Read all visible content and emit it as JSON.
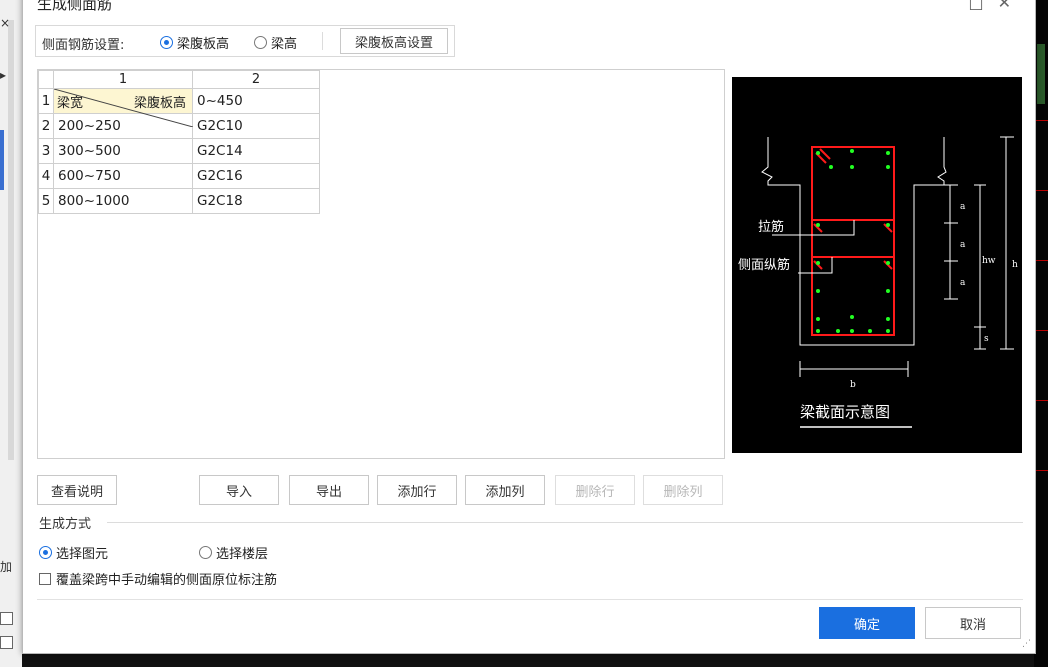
{
  "window": {
    "title": "生成侧面筋",
    "minimize": "□",
    "close": "✕"
  },
  "setting": {
    "label": "侧面钢筋设置:",
    "option_web_height": "梁腹板高",
    "option_beam_height": "梁高",
    "selected": "梁腹板高",
    "settings_button": "梁腹板高设置"
  },
  "grid": {
    "column_headers": [
      "1",
      "2"
    ],
    "row_numbers": [
      "1",
      "2",
      "3",
      "4",
      "5"
    ],
    "header_cell": {
      "top_right": "梁腹板高",
      "bottom_left": "梁宽"
    },
    "header_range": "0~450",
    "rows": [
      {
        "width": "200~250",
        "spec": "G2C10"
      },
      {
        "width": "300~500",
        "spec": "G2C14"
      },
      {
        "width": "600~750",
        "spec": "G2C16"
      },
      {
        "width": "800~1000",
        "spec": "G2C18"
      }
    ]
  },
  "diagram": {
    "label_tie": "拉筋",
    "label_side": "侧面纵筋",
    "dim_a": "a",
    "dim_hw": "hw",
    "dim_h": "h",
    "dim_s": "s",
    "dim_b": "b",
    "caption": "梁截面示意图",
    "colors": {
      "background": "#000000",
      "stirrup": "#ff1a1a",
      "bar": "#22ff22",
      "line": "#ffffff"
    }
  },
  "buttons": {
    "view_help": "查看说明",
    "import": "导入",
    "export": "导出",
    "add_row": "添加行",
    "add_col": "添加列",
    "delete_row": "删除行",
    "delete_col": "删除列",
    "ok": "确定",
    "cancel": "取消"
  },
  "generate": {
    "label": "生成方式",
    "option_select_element": "选择图元",
    "option_select_floor": "选择楼层",
    "selected": "选择图元",
    "override_checkbox": "覆盖梁跨中手动编辑的侧面原位标注筋",
    "override_checked": false
  },
  "background": {
    "left_label": "加",
    "left_top_glyph": "×",
    "left_arrow": "▸"
  },
  "accent_color": "#1a6fe0"
}
